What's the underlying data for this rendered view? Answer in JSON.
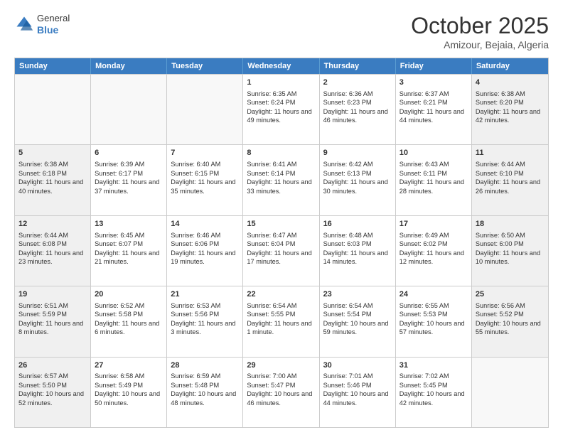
{
  "logo": {
    "general": "General",
    "blue": "Blue"
  },
  "title": "October 2025",
  "subtitle": "Amizour, Bejaia, Algeria",
  "days": [
    "Sunday",
    "Monday",
    "Tuesday",
    "Wednesday",
    "Thursday",
    "Friday",
    "Saturday"
  ],
  "rows": [
    [
      {
        "day": "",
        "content": "",
        "empty": true
      },
      {
        "day": "",
        "content": "",
        "empty": true
      },
      {
        "day": "",
        "content": "",
        "empty": true
      },
      {
        "day": "1",
        "content": "Sunrise: 6:35 AM\nSunset: 6:24 PM\nDaylight: 11 hours and 49 minutes."
      },
      {
        "day": "2",
        "content": "Sunrise: 6:36 AM\nSunset: 6:23 PM\nDaylight: 11 hours and 46 minutes."
      },
      {
        "day": "3",
        "content": "Sunrise: 6:37 AM\nSunset: 6:21 PM\nDaylight: 11 hours and 44 minutes."
      },
      {
        "day": "4",
        "content": "Sunrise: 6:38 AM\nSunset: 6:20 PM\nDaylight: 11 hours and 42 minutes.",
        "shaded": true
      }
    ],
    [
      {
        "day": "5",
        "content": "Sunrise: 6:38 AM\nSunset: 6:18 PM\nDaylight: 11 hours and 40 minutes.",
        "shaded": true
      },
      {
        "day": "6",
        "content": "Sunrise: 6:39 AM\nSunset: 6:17 PM\nDaylight: 11 hours and 37 minutes."
      },
      {
        "day": "7",
        "content": "Sunrise: 6:40 AM\nSunset: 6:15 PM\nDaylight: 11 hours and 35 minutes."
      },
      {
        "day": "8",
        "content": "Sunrise: 6:41 AM\nSunset: 6:14 PM\nDaylight: 11 hours and 33 minutes."
      },
      {
        "day": "9",
        "content": "Sunrise: 6:42 AM\nSunset: 6:13 PM\nDaylight: 11 hours and 30 minutes."
      },
      {
        "day": "10",
        "content": "Sunrise: 6:43 AM\nSunset: 6:11 PM\nDaylight: 11 hours and 28 minutes."
      },
      {
        "day": "11",
        "content": "Sunrise: 6:44 AM\nSunset: 6:10 PM\nDaylight: 11 hours and 26 minutes.",
        "shaded": true
      }
    ],
    [
      {
        "day": "12",
        "content": "Sunrise: 6:44 AM\nSunset: 6:08 PM\nDaylight: 11 hours and 23 minutes.",
        "shaded": true
      },
      {
        "day": "13",
        "content": "Sunrise: 6:45 AM\nSunset: 6:07 PM\nDaylight: 11 hours and 21 minutes."
      },
      {
        "day": "14",
        "content": "Sunrise: 6:46 AM\nSunset: 6:06 PM\nDaylight: 11 hours and 19 minutes."
      },
      {
        "day": "15",
        "content": "Sunrise: 6:47 AM\nSunset: 6:04 PM\nDaylight: 11 hours and 17 minutes."
      },
      {
        "day": "16",
        "content": "Sunrise: 6:48 AM\nSunset: 6:03 PM\nDaylight: 11 hours and 14 minutes."
      },
      {
        "day": "17",
        "content": "Sunrise: 6:49 AM\nSunset: 6:02 PM\nDaylight: 11 hours and 12 minutes."
      },
      {
        "day": "18",
        "content": "Sunrise: 6:50 AM\nSunset: 6:00 PM\nDaylight: 11 hours and 10 minutes.",
        "shaded": true
      }
    ],
    [
      {
        "day": "19",
        "content": "Sunrise: 6:51 AM\nSunset: 5:59 PM\nDaylight: 11 hours and 8 minutes.",
        "shaded": true
      },
      {
        "day": "20",
        "content": "Sunrise: 6:52 AM\nSunset: 5:58 PM\nDaylight: 11 hours and 6 minutes."
      },
      {
        "day": "21",
        "content": "Sunrise: 6:53 AM\nSunset: 5:56 PM\nDaylight: 11 hours and 3 minutes."
      },
      {
        "day": "22",
        "content": "Sunrise: 6:54 AM\nSunset: 5:55 PM\nDaylight: 11 hours and 1 minute."
      },
      {
        "day": "23",
        "content": "Sunrise: 6:54 AM\nSunset: 5:54 PM\nDaylight: 10 hours and 59 minutes."
      },
      {
        "day": "24",
        "content": "Sunrise: 6:55 AM\nSunset: 5:53 PM\nDaylight: 10 hours and 57 minutes."
      },
      {
        "day": "25",
        "content": "Sunrise: 6:56 AM\nSunset: 5:52 PM\nDaylight: 10 hours and 55 minutes.",
        "shaded": true
      }
    ],
    [
      {
        "day": "26",
        "content": "Sunrise: 6:57 AM\nSunset: 5:50 PM\nDaylight: 10 hours and 52 minutes.",
        "shaded": true
      },
      {
        "day": "27",
        "content": "Sunrise: 6:58 AM\nSunset: 5:49 PM\nDaylight: 10 hours and 50 minutes."
      },
      {
        "day": "28",
        "content": "Sunrise: 6:59 AM\nSunset: 5:48 PM\nDaylight: 10 hours and 48 minutes."
      },
      {
        "day": "29",
        "content": "Sunrise: 7:00 AM\nSunset: 5:47 PM\nDaylight: 10 hours and 46 minutes."
      },
      {
        "day": "30",
        "content": "Sunrise: 7:01 AM\nSunset: 5:46 PM\nDaylight: 10 hours and 44 minutes."
      },
      {
        "day": "31",
        "content": "Sunrise: 7:02 AM\nSunset: 5:45 PM\nDaylight: 10 hours and 42 minutes."
      },
      {
        "day": "",
        "content": "",
        "empty": true
      }
    ]
  ]
}
